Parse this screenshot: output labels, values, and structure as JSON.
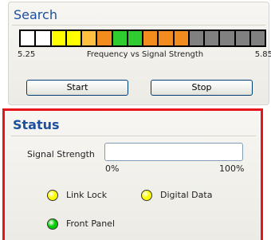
{
  "search": {
    "title": "Search",
    "segments": [
      {
        "color": "#ffffff"
      },
      {
        "color": "#ffffff"
      },
      {
        "color": "#ffff00"
      },
      {
        "color": "#ffff00"
      },
      {
        "color": "#ffbf3f"
      },
      {
        "color": "#f28c1e"
      },
      {
        "color": "#2ecc2e"
      },
      {
        "color": "#2ecc2e"
      },
      {
        "color": "#f28c1e"
      },
      {
        "color": "#f28c1e"
      },
      {
        "color": "#f28c1e"
      },
      {
        "color": "#808080"
      },
      {
        "color": "#808080"
      },
      {
        "color": "#808080"
      },
      {
        "color": "#808080"
      },
      {
        "color": "#808080"
      }
    ],
    "freq_min": "5.25",
    "freq_title": "Frequency vs Signal Strength",
    "freq_max": "5.85",
    "start_label": "Start",
    "stop_label": "Stop"
  },
  "status": {
    "title": "Status",
    "signal_label": "Signal Strength",
    "signal_value": 0,
    "signal_min_label": "0%",
    "signal_max_label": "100%",
    "indicators": {
      "link_lock": {
        "label": "Link Lock",
        "color": "#ffff00"
      },
      "digital_data": {
        "label": "Digital Data",
        "color": "#ffff00"
      },
      "front_panel": {
        "label": "Front Panel",
        "color": "#00cc00"
      }
    },
    "accent_color": "#e8141c"
  }
}
